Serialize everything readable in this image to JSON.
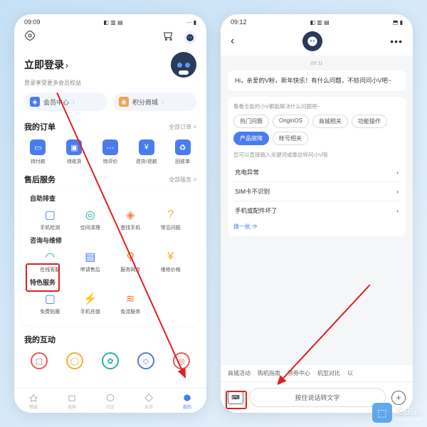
{
  "left": {
    "status_time": "09:09",
    "login_title": "立即登录",
    "login_sub": "登录享受更多会员权益",
    "pills": {
      "member": "会员中心",
      "points": "积分商城"
    },
    "orders": {
      "title": "我的订单",
      "more": "全部订单 >",
      "items": [
        "待付款",
        "待收货",
        "待评价",
        "退货/退款",
        "回收单"
      ]
    },
    "aftersale": {
      "title": "售后服务",
      "more": "全部服务 >",
      "self_check": "自助排查",
      "self_items": [
        "手机检测",
        "空间清理",
        "查找手机",
        "常见问题"
      ],
      "consult": "咨询与维修",
      "consult_items": [
        "在线客服",
        "申请售后",
        "服务网点",
        "维修价格"
      ],
      "special": "特色服务",
      "special_items": [
        "免费贴膜",
        "手机充值",
        "免流服务"
      ]
    },
    "interact": {
      "title": "我的互动"
    },
    "tabs": [
      "精选",
      "选购",
      "社区",
      "会员",
      "我的"
    ]
  },
  "right": {
    "status_time": "09:12",
    "chat_time": "09:11",
    "greeting": "Hi，亲爱的V粉，新年快乐！有什么问题，不妨问问小V吧~",
    "hint1": "看看全能的小V都能解决什么问题吧~",
    "chips": [
      "热门问题",
      "OriginOS",
      "商城相关",
      "功能操作",
      "产品故障",
      "帐号相关"
    ],
    "hint2": "您可以直接输入关键词或像这样问小V哦",
    "links": [
      "充电异常",
      "SIM卡不识别",
      "手机或配件坏了"
    ],
    "refresh": "换一批",
    "tags": [
      "商城活动",
      "购机指南",
      "领券中心",
      "机型对比",
      "以"
    ],
    "voice": "按住说话转文字"
  },
  "watermark": {
    "name": "路由器",
    "url": "luyouqi.com"
  }
}
